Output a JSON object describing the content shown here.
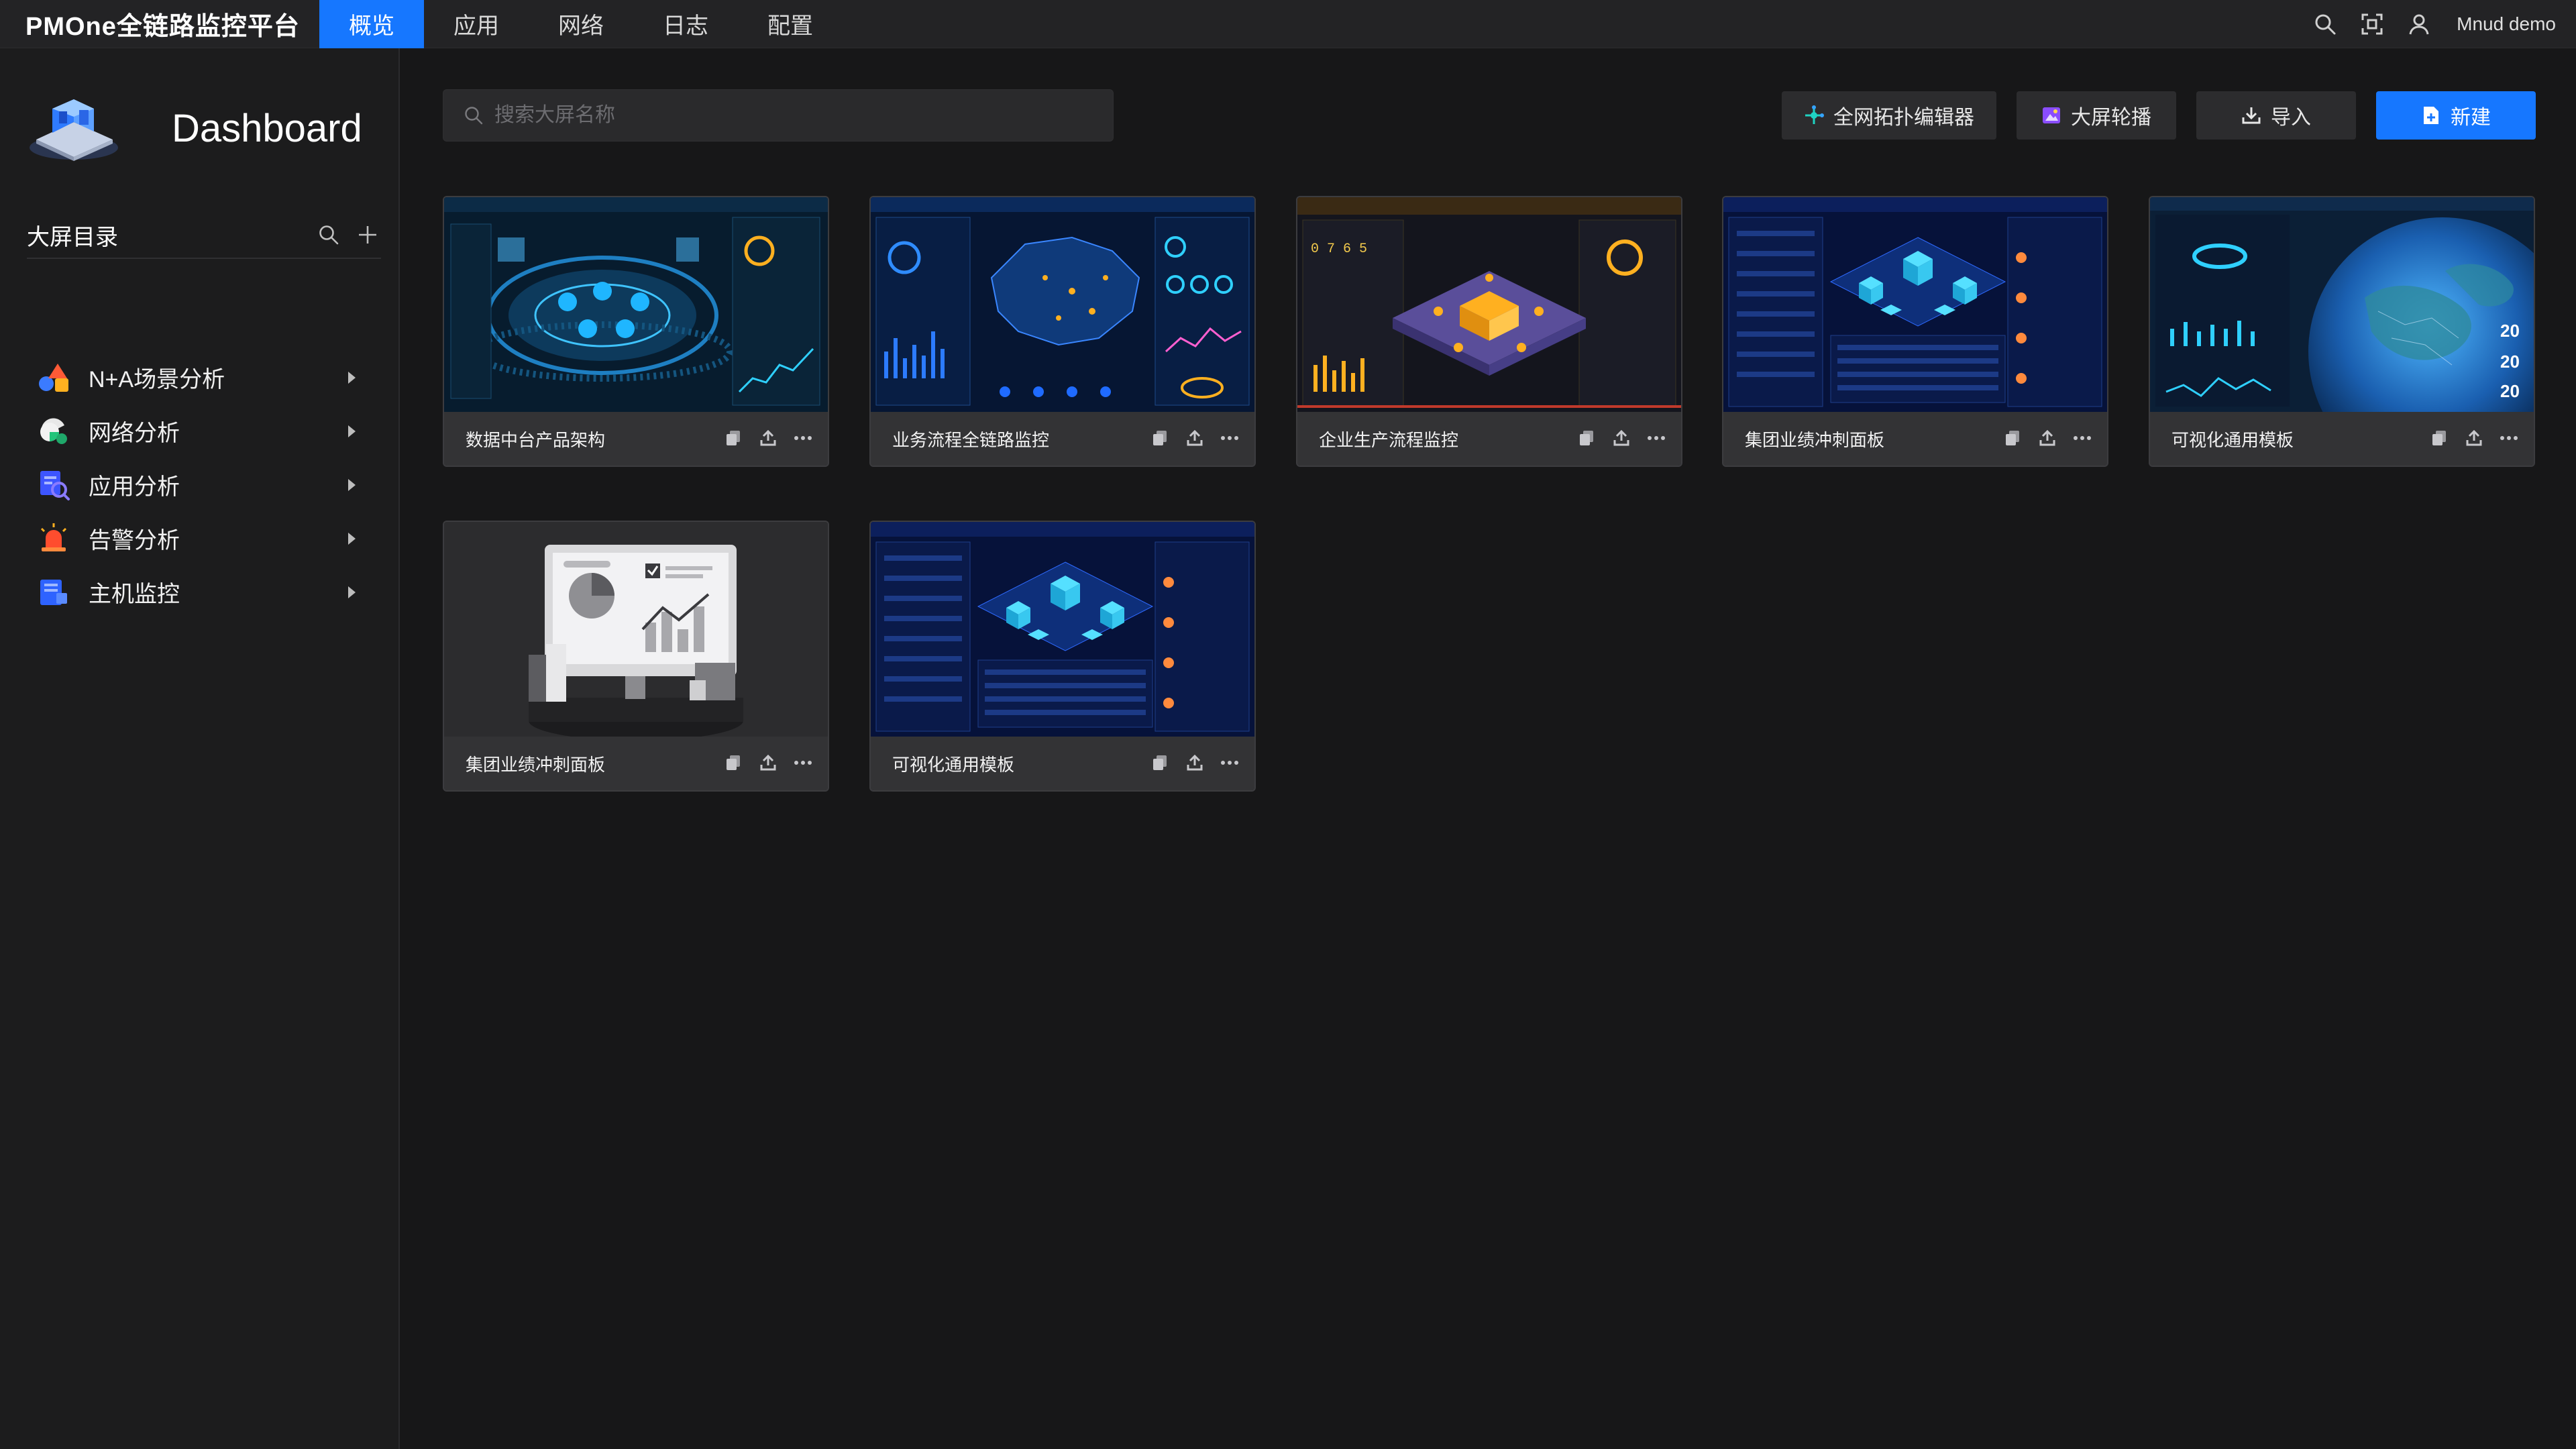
{
  "topbar": {
    "brand": "PMOne全链路监控平台",
    "nav": [
      "概览",
      "应用",
      "网络",
      "日志",
      "配置"
    ],
    "active_index": 0,
    "username": "Mnud demo"
  },
  "sidebar": {
    "title": "Dashboard",
    "directory_title": "大屏目录",
    "items": [
      {
        "label": "N+A场景分析",
        "icon": "scene-analysis-icon"
      },
      {
        "label": "网络分析",
        "icon": "network-analysis-icon"
      },
      {
        "label": "应用分析",
        "icon": "app-analysis-icon"
      },
      {
        "label": "告警分析",
        "icon": "alarm-analysis-icon"
      },
      {
        "label": "主机监控",
        "icon": "host-monitor-icon"
      }
    ]
  },
  "toolbar": {
    "search_placeholder": "搜索大屏名称",
    "topology_label": "全网拓扑编辑器",
    "carousel_label": "大屏轮播",
    "import_label": "导入",
    "new_label": "新建"
  },
  "cards": [
    {
      "name": "数据中台产品架构",
      "thumb": "platform-architecture"
    },
    {
      "name": "业务流程全链路监控",
      "thumb": "china-map"
    },
    {
      "name": "企业生产流程监控",
      "thumb": "production-isometric"
    },
    {
      "name": "集团业绩冲刺面板",
      "thumb": "group-performance"
    },
    {
      "name": "可视化通用模板",
      "thumb": "earth-globe"
    },
    {
      "name": "集团业绩冲刺面板",
      "thumb": "placeholder-monitor"
    },
    {
      "name": "可视化通用模板",
      "thumb": "group-performance"
    }
  ],
  "colors": {
    "accent": "#1677ff",
    "background": "#171718",
    "sidebar": "#1c1c1d",
    "card": "#2e2e30"
  }
}
